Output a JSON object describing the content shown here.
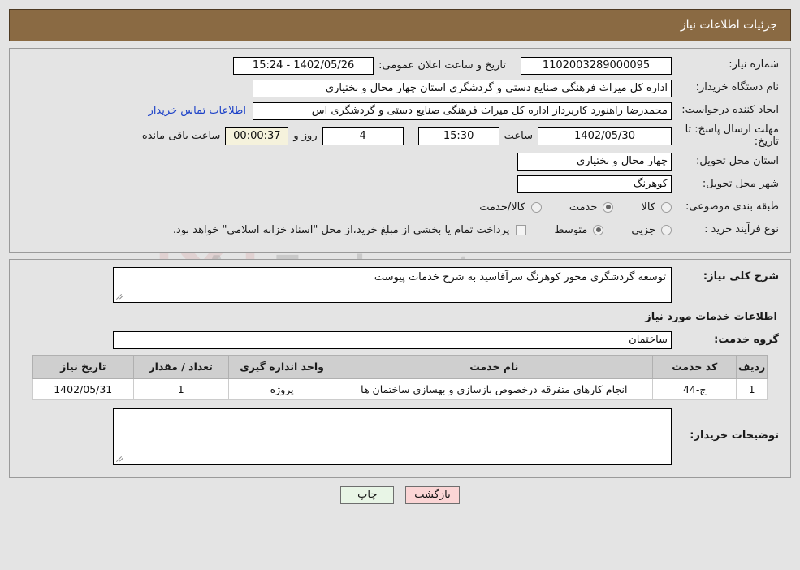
{
  "header": {
    "title": "جزئیات اطلاعات نیاز"
  },
  "form": {
    "need_number_label": "شماره نیاز:",
    "need_number_value": "1102003289000095",
    "public_announce_label": "تاریخ و ساعت اعلان عمومی:",
    "public_announce_value": "1402/05/26 - 15:24",
    "buyer_org_label": "نام دستگاه خریدار:",
    "buyer_org_value": "اداره کل میراث فرهنگی  صنایع دستی و گردشگری استان چهار محال و بختیاری",
    "creator_label": "ایجاد کننده درخواست:",
    "creator_value": "محمدرضا راهنورد کاربرداز اداره کل میراث فرهنگی  صنایع دستی و گردشگری اس",
    "contact_link": "اطلاعات تماس خریدار",
    "deadline_label": "مهلت ارسال پاسخ: تا تاریخ:",
    "deadline_date": "1402/05/30",
    "hour_label": "ساعت",
    "deadline_time": "15:30",
    "days_value": "4",
    "day_and_label": "روز و",
    "countdown_value": "00:00:37",
    "remaining_label": "ساعت باقی مانده",
    "province_label": "استان محل تحویل:",
    "province_value": "چهار محال و بختیاری",
    "city_label": "شهر محل تحویل:",
    "city_value": "کوهرنگ",
    "category_label": "طبقه بندی موضوعی:",
    "category_options": [
      {
        "label": "کالا",
        "selected": false
      },
      {
        "label": "خدمت",
        "selected": true
      },
      {
        "label": "کالا/خدمت",
        "selected": false
      }
    ],
    "process_label": "نوع فرآیند خرید :",
    "process_options": [
      {
        "label": "جزیی",
        "selected": false
      },
      {
        "label": "متوسط",
        "selected": true
      }
    ],
    "treasury_checkbox_checked": false,
    "treasury_note": "پرداخت تمام یا بخشی از مبلغ خرید،از محل \"اسناد خزانه اسلامی\" خواهد بود."
  },
  "details": {
    "need_desc_label": "شرح کلی نیاز:",
    "need_desc_value": "توسعه گردشگری محور کوهرنگ سرآقاسید به شرح خدمات پیوست",
    "services_section_title": "اطلاعات خدمات مورد نیاز",
    "service_group_label": "گروه خدمت:",
    "service_group_value": "ساختمان",
    "buyer_notes_label": "توضیحات خریدار:",
    "buyer_notes_value": ""
  },
  "table": {
    "columns": [
      "ردیف",
      "کد خدمت",
      "نام خدمت",
      "واحد اندازه گیری",
      "تعداد / مقدار",
      "تاریخ نیاز"
    ],
    "rows": [
      {
        "radif": "1",
        "code": "ج-44",
        "name": "انجام کارهای متفرقه درخصوص بازسازی و بهسازی ساختمان ها",
        "unit": "پروژه",
        "qty": "1",
        "date": "1402/05/31"
      }
    ]
  },
  "footer": {
    "print_label": "چاپ",
    "back_label": "بازگشت"
  },
  "watermark": {
    "text": "AnaTender.net"
  },
  "colors": {
    "header_bar": "#8a6a43",
    "page_bg": "#e4e4e4",
    "link": "#1d42c8",
    "countdown_bg": "#f5f2dc",
    "print_btn": "#e8f5e6",
    "back_btn": "#fbd5d5",
    "table_header": "#cfcfcf"
  }
}
